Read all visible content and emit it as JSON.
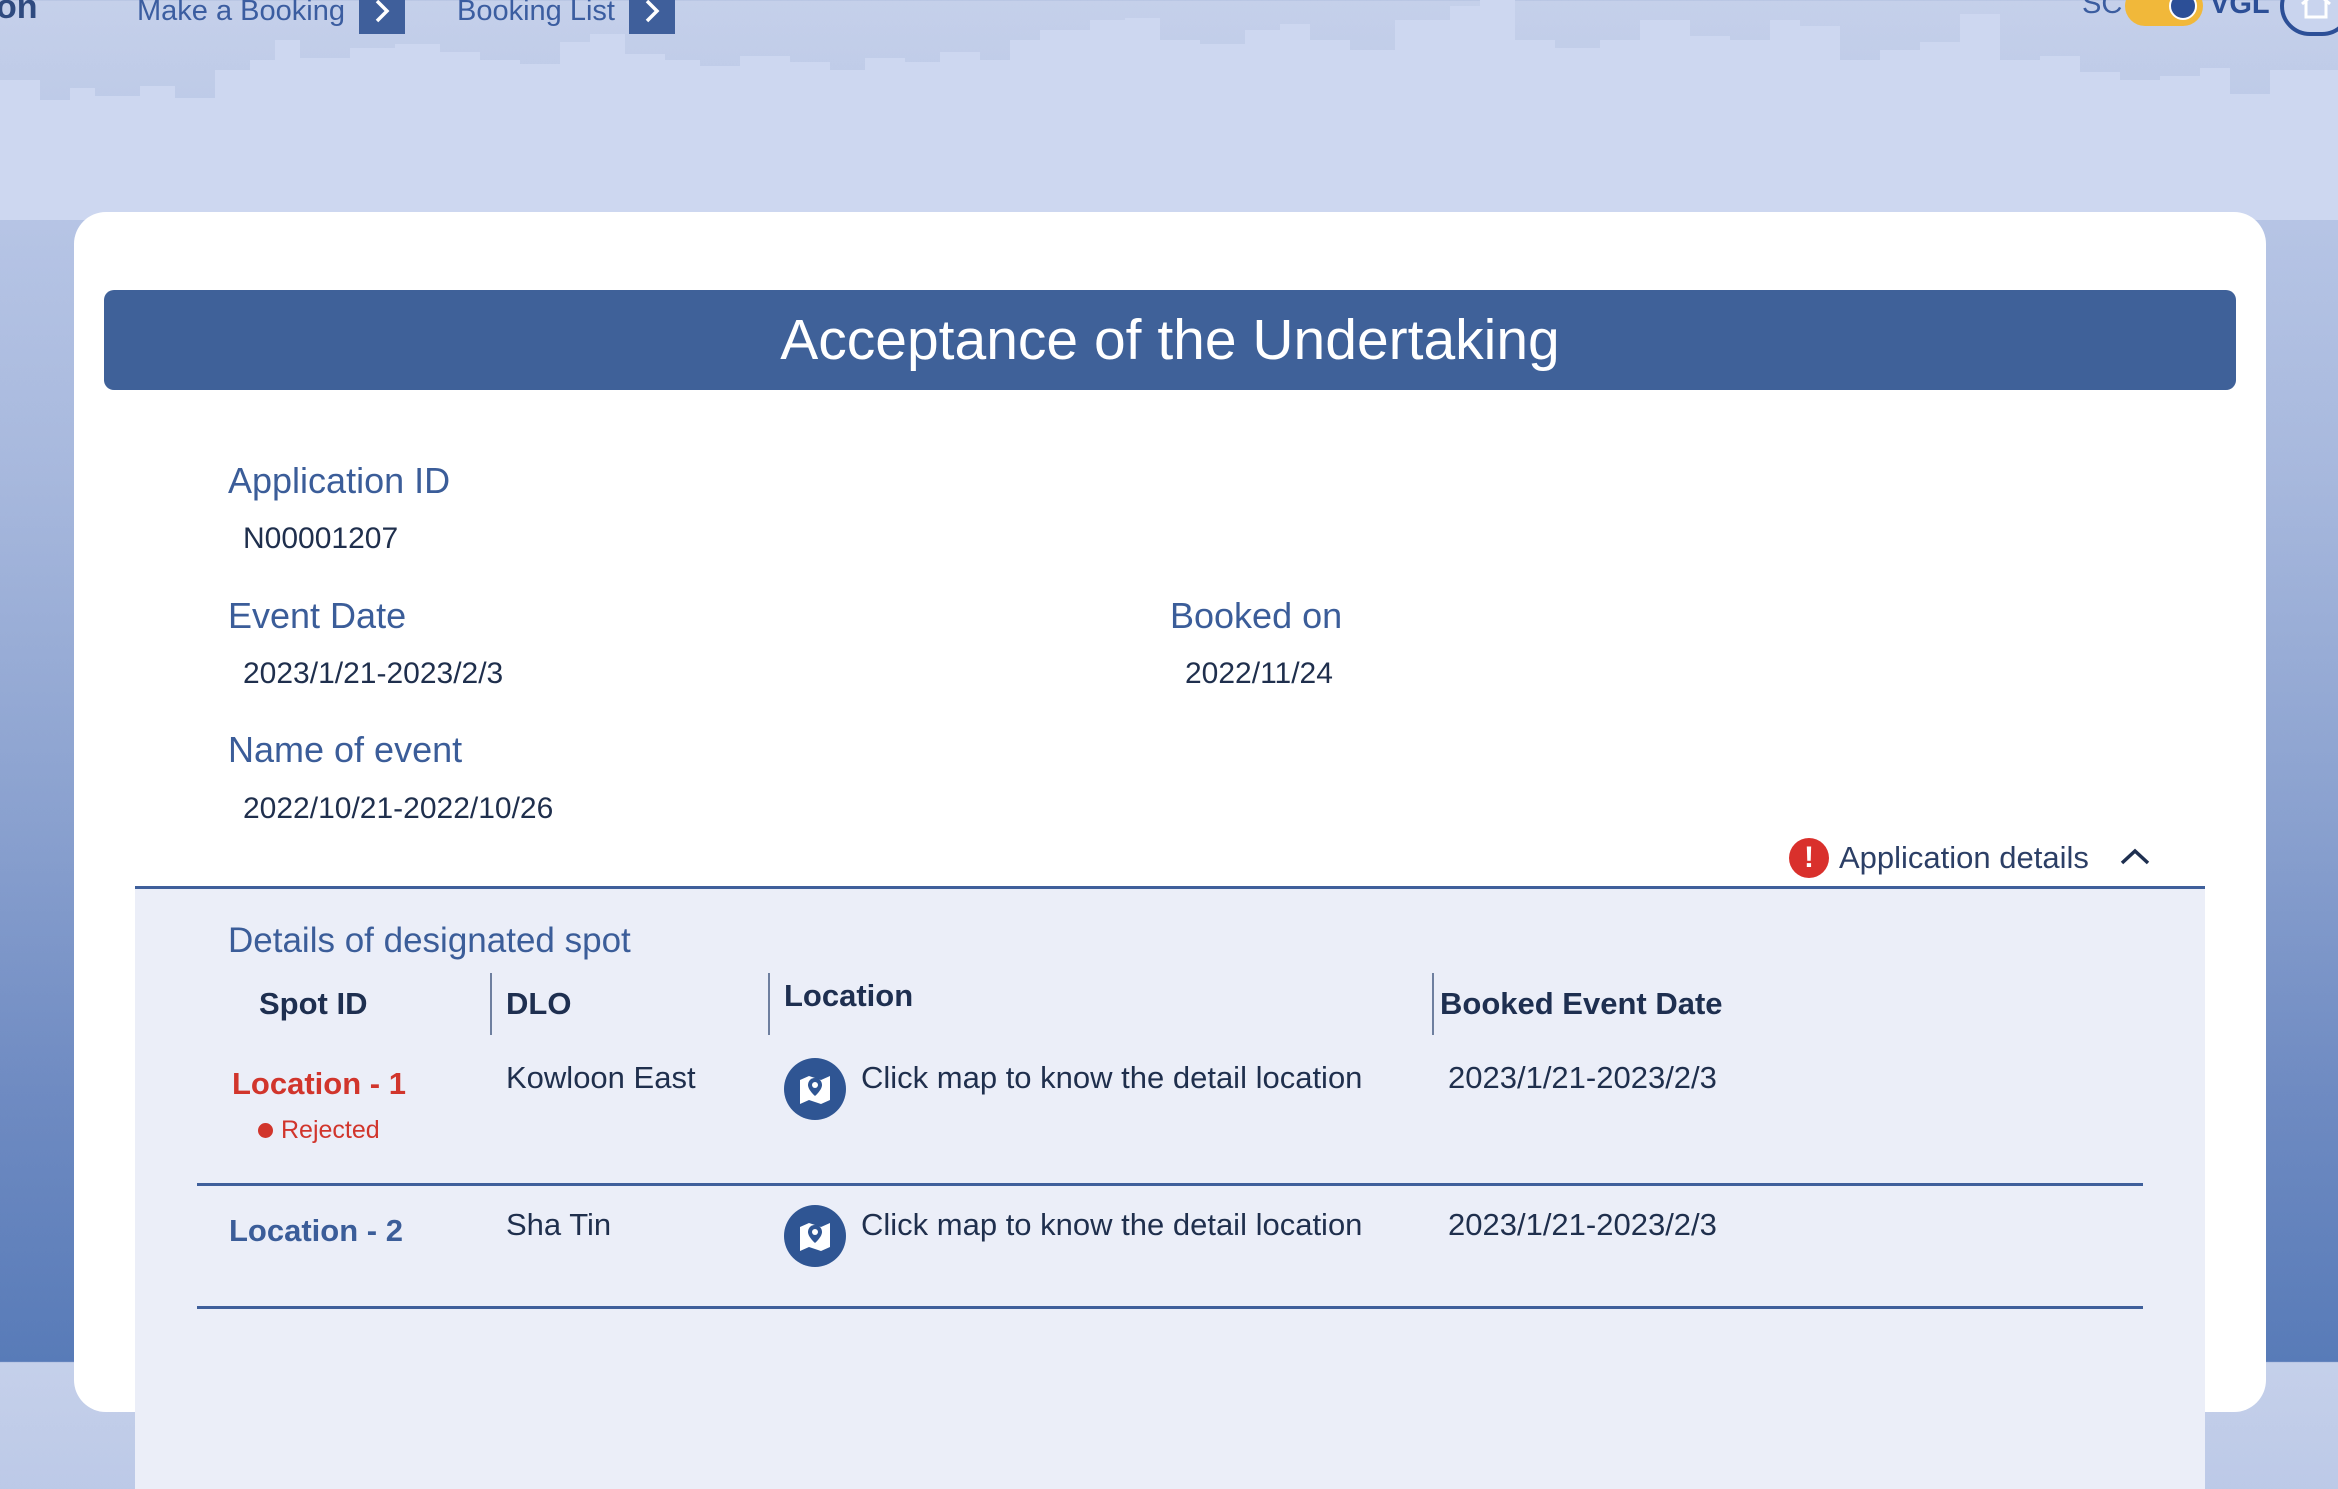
{
  "header": {
    "brand_tail": "on",
    "nav": [
      {
        "label": "Make a Booking"
      },
      {
        "label": "Booking List"
      }
    ],
    "lang_sc": "SC",
    "lang_vgl": "VGL"
  },
  "page": {
    "title": "Acceptance of the Undertaking"
  },
  "application": {
    "id_label": "Application ID",
    "id_value": "N00001207",
    "event_date_label": "Event Date",
    "event_date_value": "2023/1/21-2023/2/3",
    "booked_on_label": "Booked on",
    "booked_on_value": "2022/11/24",
    "event_name_label": "Name of event",
    "event_name_value": "2022/10/21-2022/10/26",
    "details_toggle_label": "Application details"
  },
  "spots": {
    "title": "Details of designated spot",
    "columns": [
      "Spot ID",
      "DLO",
      "Location",
      "Booked Event Date"
    ],
    "rows": [
      {
        "spot_id": "Location - 1",
        "status": "Rejected",
        "dlo": "Kowloon East",
        "location_text": "Click map to know the detail location",
        "booked_date": "2023/1/21-2023/2/3"
      },
      {
        "spot_id": "Location - 2",
        "status": "",
        "dlo": "Sha Tin",
        "location_text": "Click map to know the detail location",
        "booked_date": "2023/1/21-2023/2/3"
      }
    ]
  },
  "colors": {
    "primary": "#3f6199",
    "rejected": "#d1352c",
    "toggle": "#f1b83a"
  },
  "icons": {
    "nav_arrow": "chevron-right-icon",
    "home": "home-icon",
    "alert": "exclamation-icon",
    "collapse": "chevron-up-icon",
    "map": "map-pin-icon"
  }
}
